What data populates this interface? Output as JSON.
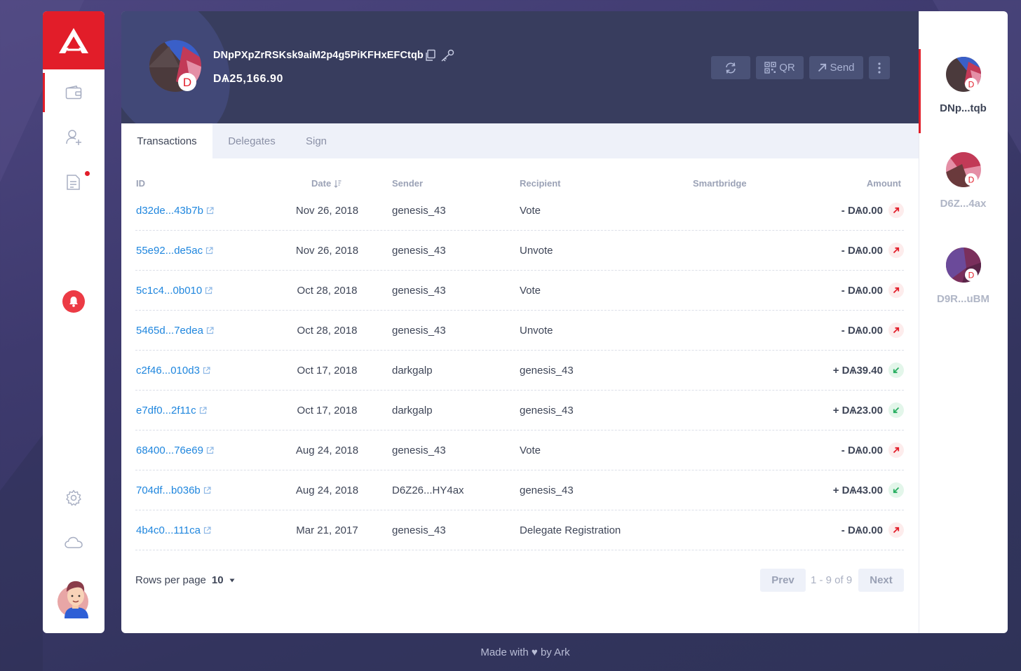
{
  "header": {
    "address": "DNpPXpZrRSKsk9aiM2p4g5PiKFHxEFCtqb",
    "balance": "DѦ25,166.90",
    "avatar_letter": "D",
    "buttons": {
      "qr": "QR",
      "send": "Send"
    }
  },
  "tabs": [
    "Transactions",
    "Delegates",
    "Sign"
  ],
  "table": {
    "columns": {
      "id": "ID",
      "date": "Date",
      "sender": "Sender",
      "recipient": "Recipient",
      "smartbridge": "Smartbridge",
      "amount": "Amount"
    },
    "rows": [
      {
        "id": "d32de...43b7b",
        "date": "Nov 26, 2018",
        "sender": "genesis_43",
        "recipient": "Vote",
        "amount": "- DѦ0.00",
        "direction": "out"
      },
      {
        "id": "55e92...de5ac",
        "date": "Nov 26, 2018",
        "sender": "genesis_43",
        "recipient": "Unvote",
        "amount": "- DѦ0.00",
        "direction": "out"
      },
      {
        "id": "5c1c4...0b010",
        "date": "Oct 28, 2018",
        "sender": "genesis_43",
        "recipient": "Vote",
        "amount": "- DѦ0.00",
        "direction": "out"
      },
      {
        "id": "5465d...7edea",
        "date": "Oct 28, 2018",
        "sender": "genesis_43",
        "recipient": "Unvote",
        "amount": "- DѦ0.00",
        "direction": "out"
      },
      {
        "id": "c2f46...010d3",
        "date": "Oct 17, 2018",
        "sender": "darkgalp",
        "recipient": "genesis_43",
        "amount": "+ DѦ39.40",
        "direction": "in"
      },
      {
        "id": "e7df0...2f11c",
        "date": "Oct 17, 2018",
        "sender": "darkgalp",
        "recipient": "genesis_43",
        "amount": "+ DѦ23.00",
        "direction": "in"
      },
      {
        "id": "68400...76e69",
        "date": "Aug 24, 2018",
        "sender": "genesis_43",
        "recipient": "Vote",
        "amount": "- DѦ0.00",
        "direction": "out"
      },
      {
        "id": "704df...b036b",
        "date": "Aug 24, 2018",
        "sender": "D6Z26...HY4ax",
        "recipient": "genesis_43",
        "amount": "+ DѦ43.00",
        "direction": "in"
      },
      {
        "id": "4b4c0...111ca",
        "date": "Mar 21, 2017",
        "sender": "genesis_43",
        "recipient": "Delegate Registration",
        "amount": "- DѦ0.00",
        "direction": "out"
      }
    ]
  },
  "pagination": {
    "rows_label": "Rows per page",
    "rows_value": "10",
    "prev": "Prev",
    "info": "1 - 9 of 9",
    "next": "Next"
  },
  "wallets": [
    {
      "name": "DNp...tqb",
      "letter": "D",
      "active": true
    },
    {
      "name": "D6Z...4ax",
      "letter": "D",
      "active": false
    },
    {
      "name": "D9R...uBM",
      "letter": "D",
      "active": false
    }
  ],
  "footer": "Made with ♥ by Ark",
  "colors": {
    "accent": "#e21d29",
    "link": "#1f86de",
    "header_bg": "#383d5e",
    "positive": "#27ae60"
  }
}
